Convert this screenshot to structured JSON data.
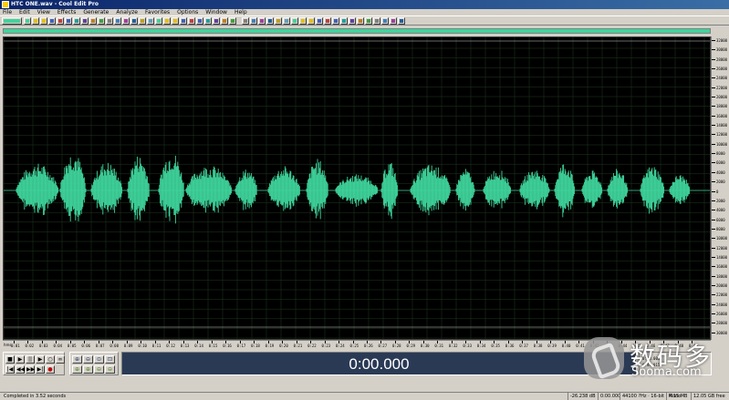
{
  "window": {
    "title": "HTC ONE.wav - Cool Edit Pro"
  },
  "menu": [
    "File",
    "Edit",
    "View",
    "Effects",
    "Generate",
    "Analyze",
    "Favorites",
    "Options",
    "Window",
    "Help"
  ],
  "ruler": {
    "unit": "hms",
    "vertical_labels": [
      "32000",
      "30000",
      "28000",
      "26000",
      "24000",
      "22000",
      "20000",
      "18000",
      "16000",
      "14000",
      "12000",
      "10000",
      "8000",
      "6000",
      "4000",
      "2000",
      "0",
      "2000",
      "4000",
      "6000",
      "8000",
      "10000",
      "12000",
      "14000",
      "16000",
      "18000",
      "20000",
      "22000",
      "24000",
      "26000",
      "28000",
      "30000"
    ],
    "time_labels": [
      "0:01",
      "0:02",
      "0:03",
      "0:04",
      "0:05",
      "0:06",
      "0:07",
      "0:08",
      "0:09",
      "0:10",
      "0:11",
      "0:12",
      "0:13",
      "0:14",
      "0:15",
      "0:16",
      "0:17",
      "0:18",
      "0:19",
      "0:20",
      "0:21",
      "0:22",
      "0:23",
      "0:24",
      "0:25",
      "0:26",
      "0:27",
      "0:28",
      "0:29",
      "0:30",
      "0:31",
      "0:32",
      "0:33",
      "0:34",
      "0:35",
      "0:36",
      "0:37",
      "0:38",
      "0:39",
      "0:40",
      "0:41",
      "0:42",
      "0:43",
      "0:44",
      "0:45",
      "0:46",
      "0:47",
      "0:48",
      "0:49"
    ]
  },
  "transport": {
    "row1": [
      "■",
      "▶",
      "||",
      "▶",
      "○",
      "∞"
    ],
    "row2": [
      "|◀",
      "◀◀",
      "▶▶",
      "▶|",
      "●"
    ]
  },
  "zoom": {
    "row1": [
      "⊕",
      "⊖",
      "⊙",
      "⊡"
    ],
    "row2": [
      "⊕",
      "⊕",
      "⊖",
      "⊖"
    ]
  },
  "time_display": "0:00.000",
  "selection": {
    "begin": "0:00.000",
    "end": "0:49.015"
  },
  "status": {
    "left": "Completed in 3.52 seconds",
    "cells": [
      "-26.238 dB",
      "0:00.000",
      "44100 ?Hz · 16-bit · Mono",
      "4.15 MB",
      "12.05 GB free"
    ]
  },
  "colors": {
    "waveform": "#3fd49c",
    "background": "#000000",
    "grid": "#1f3a1f",
    "window": "#d4d0c8"
  },
  "watermark": {
    "cn": "数码多",
    "en": "Sooma.com"
  }
}
